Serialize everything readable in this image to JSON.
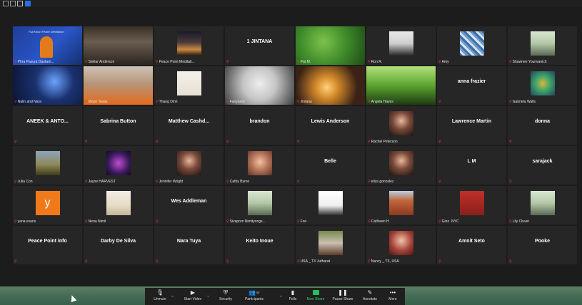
{
  "window": {
    "top_icons": [
      "grid-icon",
      "window-icon",
      "window-icon",
      "blue-square-icon"
    ]
  },
  "participants": [
    {
      "name": "Phra Pasura Dantam...",
      "type": "video",
      "scene": "banner",
      "active": true,
      "banner_text": "Full Moon Peace Meditation"
    },
    {
      "name": "Stellar Anderson",
      "type": "video",
      "scene": "window"
    },
    {
      "name": "Peace Point Meditati...",
      "type": "image",
      "scene": "sunset"
    },
    {
      "name": "1 JINTANA",
      "type": "name"
    },
    {
      "name": "Pat M.",
      "type": "video",
      "scene": "plants"
    },
    {
      "name": "Ron R.",
      "type": "image",
      "scene": "portrait"
    },
    {
      "name": "Amy",
      "type": "image",
      "scene": "pattern"
    },
    {
      "name": "Shawnee Younvanich",
      "type": "image",
      "scene": "portrait-light"
    },
    {
      "name": "Nalin and Nara",
      "type": "video",
      "scene": "night"
    },
    {
      "name": "Moon Texas",
      "type": "video",
      "scene": "orange"
    },
    {
      "name": "Thang Dinh",
      "type": "image",
      "scene": "cartoon"
    },
    {
      "name": "Fanyaree",
      "type": "video",
      "scene": "moon"
    },
    {
      "name": "Jintana",
      "type": "video",
      "scene": "lamp"
    },
    {
      "name": "Angela Hayes",
      "type": "video",
      "scene": "green"
    },
    {
      "name": "anna frazier",
      "type": "name"
    },
    {
      "name": "Gabriela Walls",
      "type": "image",
      "scene": "art"
    },
    {
      "name": "ANEEK & ANTO...",
      "type": "name"
    },
    {
      "name": "Sabrina Button",
      "type": "name"
    },
    {
      "name": "Matthew  Cashd...",
      "type": "name"
    },
    {
      "name": "brandon",
      "type": "name"
    },
    {
      "name": "Lewis Anderson",
      "type": "name"
    },
    {
      "name": "Rachel Peterson",
      "type": "image",
      "scene": "portrait-dark"
    },
    {
      "name": "Lawrence Martin",
      "type": "name"
    },
    {
      "name": "donna",
      "type": "name"
    },
    {
      "name": "Julia Con",
      "type": "image",
      "scene": "landscape"
    },
    {
      "name": "Jayne HARVEST",
      "type": "image",
      "scene": "purple"
    },
    {
      "name": "Jennifer Wright",
      "type": "image",
      "scene": "portrait-dark"
    },
    {
      "name": "Cathy Byrne",
      "type": "image",
      "scene": "portrait-warm"
    },
    {
      "name": "Belle",
      "type": "name"
    },
    {
      "name": "eliza gonzalez",
      "type": "image",
      "scene": "portrait-dark"
    },
    {
      "name": "L M",
      "type": "name"
    },
    {
      "name": "sarajack",
      "type": "name"
    },
    {
      "name": "yana evans",
      "type": "letter",
      "letter": "y"
    },
    {
      "name": "Nena Nimit",
      "type": "image",
      "scene": "beach"
    },
    {
      "name": "Wes Addleman",
      "type": "name"
    },
    {
      "name": "Sivaporn Nimityongs...",
      "type": "image",
      "scene": "portrait-light"
    },
    {
      "name": "Fon",
      "type": "image",
      "scene": "portrait-white"
    },
    {
      "name": "Cathleen H",
      "type": "image",
      "scene": "canyon"
    },
    {
      "name": "Ginn .NYC",
      "type": "image",
      "scene": "red"
    },
    {
      "name": "Lily Cluver",
      "type": "image",
      "scene": "portrait-light"
    },
    {
      "name": "Peace Point info",
      "type": "name"
    },
    {
      "name": "Darby De Silva",
      "type": "name"
    },
    {
      "name": "Nara Tuya",
      "type": "name"
    },
    {
      "name": "Keito Inoue",
      "type": "name"
    },
    {
      "name": "USA _ TX Jutharat",
      "type": "image",
      "scene": "garden"
    },
    {
      "name": "Nancy _ TX, USA",
      "type": "image",
      "scene": "portrait-red"
    },
    {
      "name": "Amnit Seto",
      "type": "name"
    },
    {
      "name": "Pooke",
      "type": "name"
    }
  ],
  "toolbar": [
    {
      "key": "unmute",
      "label": "Unmute",
      "icon": "mic-muted-icon",
      "glyph": "🎙",
      "caret": true
    },
    {
      "key": "start_video",
      "label": "Start Video",
      "icon": "video-camera-icon",
      "glyph": "▶",
      "caret": true
    },
    {
      "key": "security",
      "label": "Security",
      "icon": "shield-icon",
      "glyph": "⛨",
      "caret": false
    },
    {
      "key": "participants",
      "label": "Participants",
      "icon": "people-icon",
      "glyph": "👥",
      "count": "57",
      "caret": true
    },
    {
      "key": "polls",
      "label": "Polls",
      "icon": "bar-chart-icon",
      "glyph": "▮",
      "caret": false
    },
    {
      "key": "new_share",
      "label": "New Share",
      "icon": "share-screen-icon",
      "glyph": "",
      "caret": false
    },
    {
      "key": "pause_share",
      "label": "Pause Share",
      "icon": "pause-icon",
      "glyph": "❚❚",
      "caret": false
    },
    {
      "key": "annotate",
      "label": "Annotate",
      "icon": "pencil-icon",
      "glyph": "✎",
      "caret": false
    },
    {
      "key": "more",
      "label": "More",
      "icon": "more-icon",
      "glyph": "•••",
      "caret": false
    }
  ],
  "colors": {
    "active_border": "#f4c542",
    "share_green": "#25c05c",
    "muted_red": "#e23b3b"
  }
}
